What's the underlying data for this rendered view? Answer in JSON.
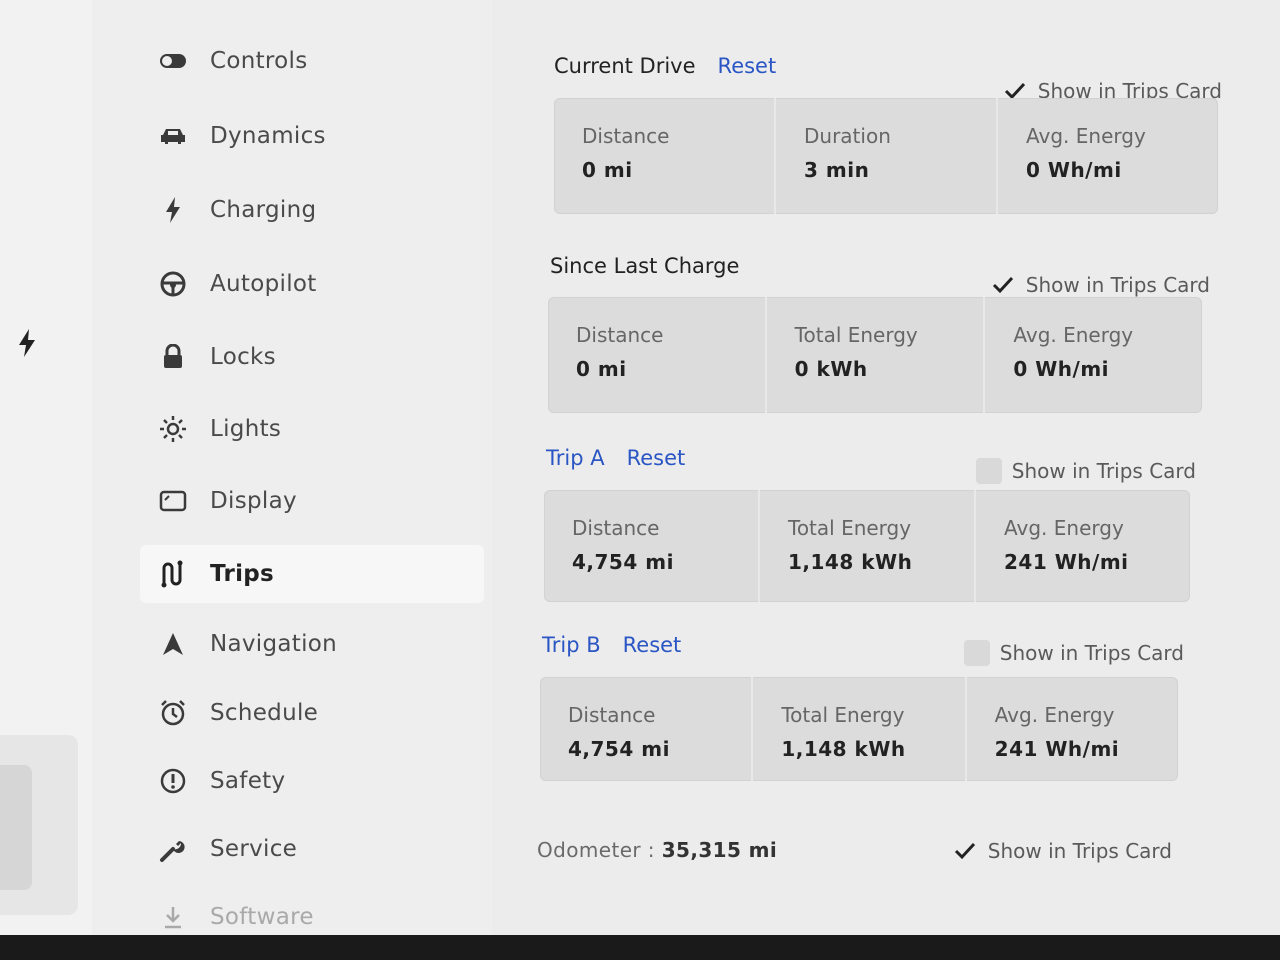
{
  "sidebar": {
    "items": [
      {
        "label": "Controls",
        "icon": "toggle-icon"
      },
      {
        "label": "Dynamics",
        "icon": "car-icon"
      },
      {
        "label": "Charging",
        "icon": "bolt-icon"
      },
      {
        "label": "Autopilot",
        "icon": "steering-wheel-icon"
      },
      {
        "label": "Locks",
        "icon": "lock-icon"
      },
      {
        "label": "Lights",
        "icon": "sun-icon"
      },
      {
        "label": "Display",
        "icon": "display-icon"
      },
      {
        "label": "Trips",
        "icon": "trips-icon",
        "active": true
      },
      {
        "label": "Navigation",
        "icon": "navigation-arrow-icon"
      },
      {
        "label": "Schedule",
        "icon": "alarm-clock-icon"
      },
      {
        "label": "Safety",
        "icon": "alert-circle-icon"
      },
      {
        "label": "Service",
        "icon": "wrench-icon"
      },
      {
        "label": "Software",
        "icon": "download-icon"
      }
    ]
  },
  "current_drive": {
    "title": "Current Drive",
    "reset": "Reset",
    "show_in_trips_card": {
      "label": "Show in Trips Card",
      "checked": true
    },
    "stats": [
      {
        "label": "Distance",
        "value": "0 mi"
      },
      {
        "label": "Duration",
        "value": "3 min"
      },
      {
        "label": "Avg. Energy",
        "value": "0 Wh/mi"
      }
    ]
  },
  "since_last_charge": {
    "title": "Since Last Charge",
    "show_in_trips_card": {
      "label": "Show in Trips Card",
      "checked": true
    },
    "stats": [
      {
        "label": "Distance",
        "value": "0 mi"
      },
      {
        "label": "Total Energy",
        "value": "0 kWh"
      },
      {
        "label": "Avg. Energy",
        "value": "0 Wh/mi"
      }
    ]
  },
  "trip_a": {
    "title": "Trip A",
    "reset": "Reset",
    "show_in_trips_card": {
      "label": "Show in Trips Card",
      "checked": false
    },
    "stats": [
      {
        "label": "Distance",
        "value": "4,754 mi"
      },
      {
        "label": "Total Energy",
        "value": "1,148 kWh"
      },
      {
        "label": "Avg. Energy",
        "value": "241 Wh/mi"
      }
    ]
  },
  "trip_b": {
    "title": "Trip B",
    "reset": "Reset",
    "show_in_trips_card": {
      "label": "Show in Trips Card",
      "checked": false
    },
    "stats": [
      {
        "label": "Distance",
        "value": "4,754 mi"
      },
      {
        "label": "Total Energy",
        "value": "1,148 kWh"
      },
      {
        "label": "Avg. Energy",
        "value": "241 Wh/mi"
      }
    ]
  },
  "odometer": {
    "label": "Odometer",
    "separator": ":",
    "value": "35,315 mi",
    "show_in_trips_card": {
      "label": "Show in Trips Card",
      "checked": true
    }
  },
  "colors": {
    "accent": "#2a55c4",
    "background": "#ececec",
    "panel": "#dcdcdc"
  }
}
